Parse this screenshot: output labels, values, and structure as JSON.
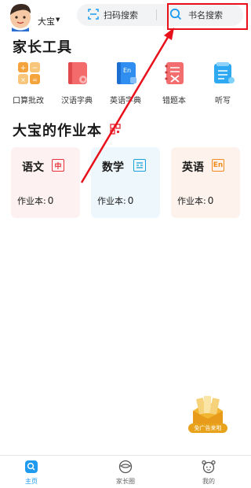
{
  "header": {
    "child_name": "大宝",
    "scan_label": "扫码搜索",
    "book_search_label": "书名搜索"
  },
  "parent_tools": {
    "title": "家长工具",
    "items": [
      {
        "label": "口算批改",
        "icon": "calculator-icon"
      },
      {
        "label": "汉语字典",
        "icon": "chinese-dictionary-icon"
      },
      {
        "label": "英语字典",
        "icon": "english-dictionary-icon"
      },
      {
        "label": "错题本",
        "icon": "mistake-notebook-icon"
      },
      {
        "label": "听写",
        "icon": "dictation-icon"
      }
    ]
  },
  "homework": {
    "title": "大宝的作业本",
    "cards": [
      {
        "subject": "语文",
        "badge": "中",
        "count_label": "作业本:",
        "count": "0",
        "color": "#e8313a",
        "bg": "#fdf1f1"
      },
      {
        "subject": "数学",
        "badge": "",
        "count_label": "作业本:",
        "count": "0",
        "color": "#1aa2d8",
        "bg": "#eef8fc"
      },
      {
        "subject": "英语",
        "badge": "En",
        "count_label": "作业本:",
        "count": "0",
        "color": "#f08a1c",
        "bg": "#fdf3ec"
      }
    ]
  },
  "ad": {
    "label": "免广告来啦"
  },
  "bottom_nav": {
    "items": [
      {
        "label": "主页",
        "icon": "home-icon",
        "active": true
      },
      {
        "label": "家长圈",
        "icon": "parent-circle-icon",
        "active": false
      },
      {
        "label": "我的",
        "icon": "profile-icon",
        "active": false
      }
    ]
  },
  "colors": {
    "accent_blue": "#1e9bf0",
    "highlight_red": "#e8101a"
  }
}
